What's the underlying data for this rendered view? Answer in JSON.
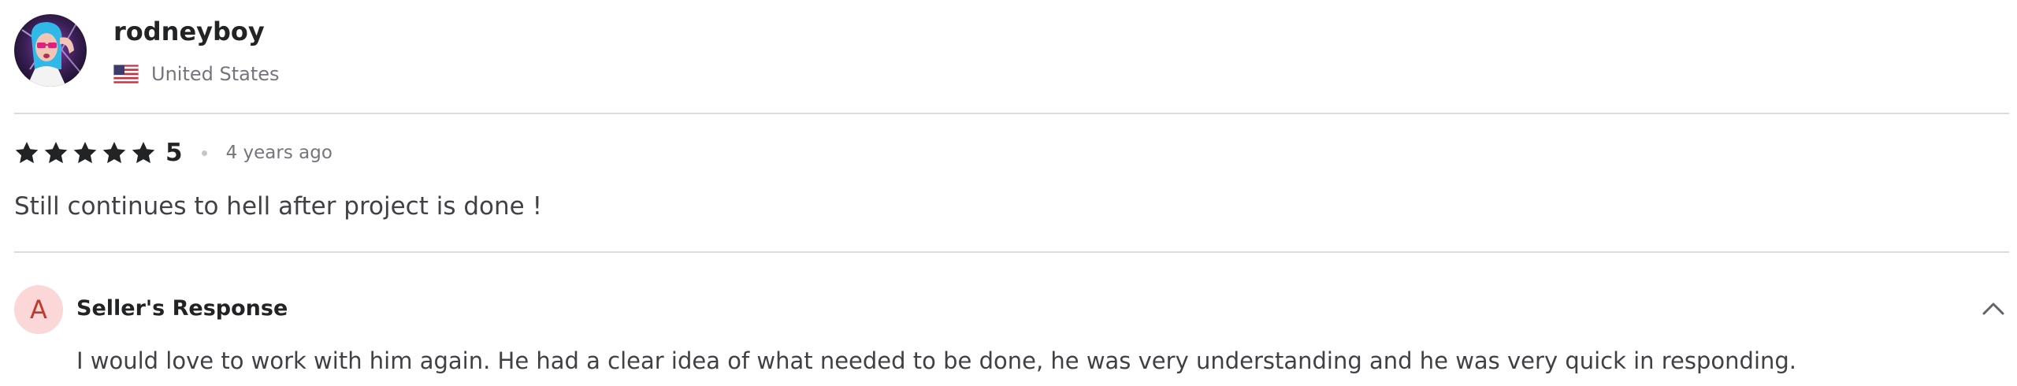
{
  "review": {
    "username": "rodneyboy",
    "country": "United States",
    "rating": "5",
    "rating_stars": 5,
    "time_ago": "4 years ago",
    "text": "Still continues to hell after project is done !"
  },
  "seller_response": {
    "avatar_initial": "A",
    "title": "Seller's Response",
    "text": "I would love to work with him again. He had a clear idea of what needed to be done, he was very understanding and he was very quick in responding."
  },
  "colors": {
    "star": "#222325",
    "divider": "#dadbdd",
    "seller_avatar_bg": "#fbd7d7",
    "seller_avatar_letter": "#c0392b"
  },
  "icons": {
    "avatar": "user-avatar-image",
    "flag": "us-flag-icon",
    "star": "star-icon",
    "collapse": "chevron-up-icon"
  }
}
